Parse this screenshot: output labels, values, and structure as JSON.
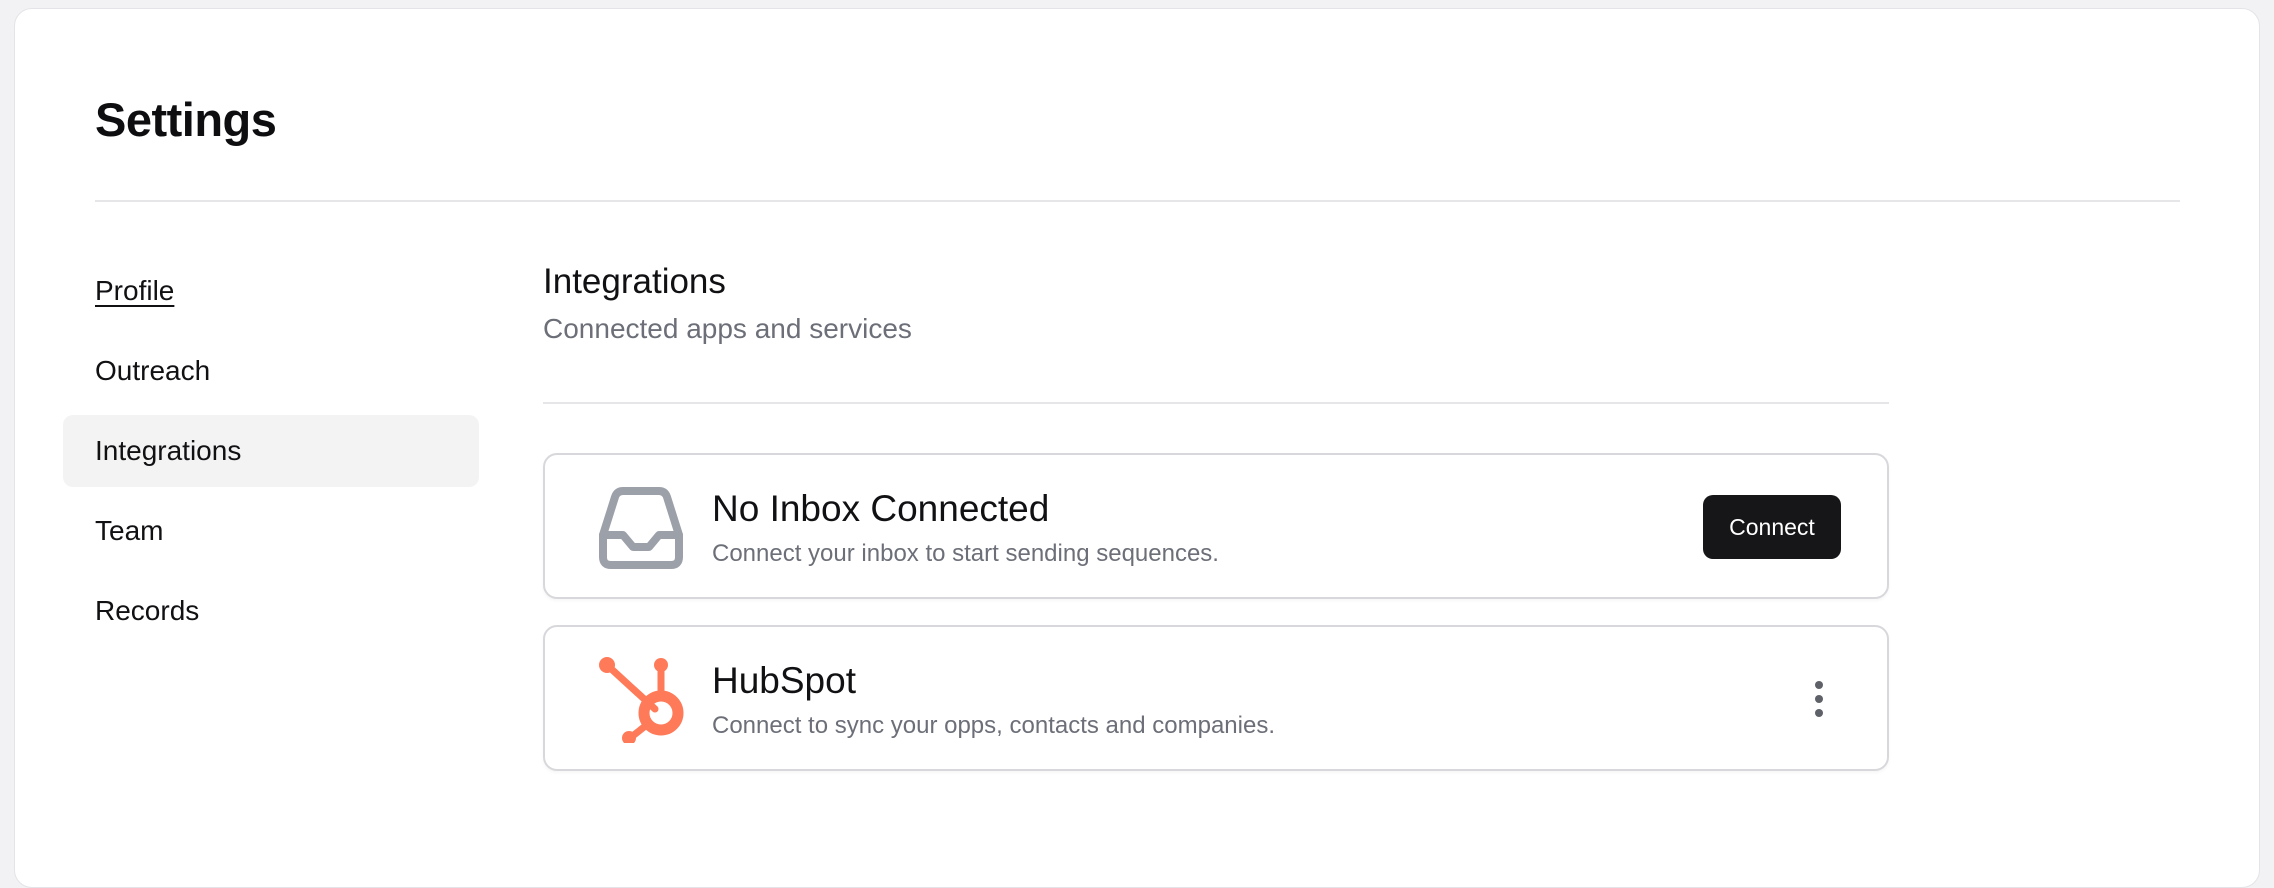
{
  "page": {
    "title": "Settings"
  },
  "sidebar": {
    "items": [
      {
        "label": "Profile"
      },
      {
        "label": "Outreach"
      },
      {
        "label": "Integrations"
      },
      {
        "label": "Team"
      },
      {
        "label": "Records"
      }
    ]
  },
  "section": {
    "title": "Integrations",
    "subtitle": "Connected apps and services"
  },
  "integrations": [
    {
      "name": "No Inbox Connected",
      "description": "Connect your inbox to start sending sequences.",
      "icon": "inbox-tray-icon",
      "action_label": "Connect"
    },
    {
      "name": "HubSpot",
      "description": "Connect to sync your opps, contacts and companies.",
      "icon": "hubspot-logo-icon",
      "action_icon": "more-vertical-icon"
    }
  ],
  "colors": {
    "hubspot_orange": "#ff7a59",
    "button_dark": "#161618",
    "muted_text": "#6c6f78",
    "active_nav_bg": "#f3f3f4"
  }
}
